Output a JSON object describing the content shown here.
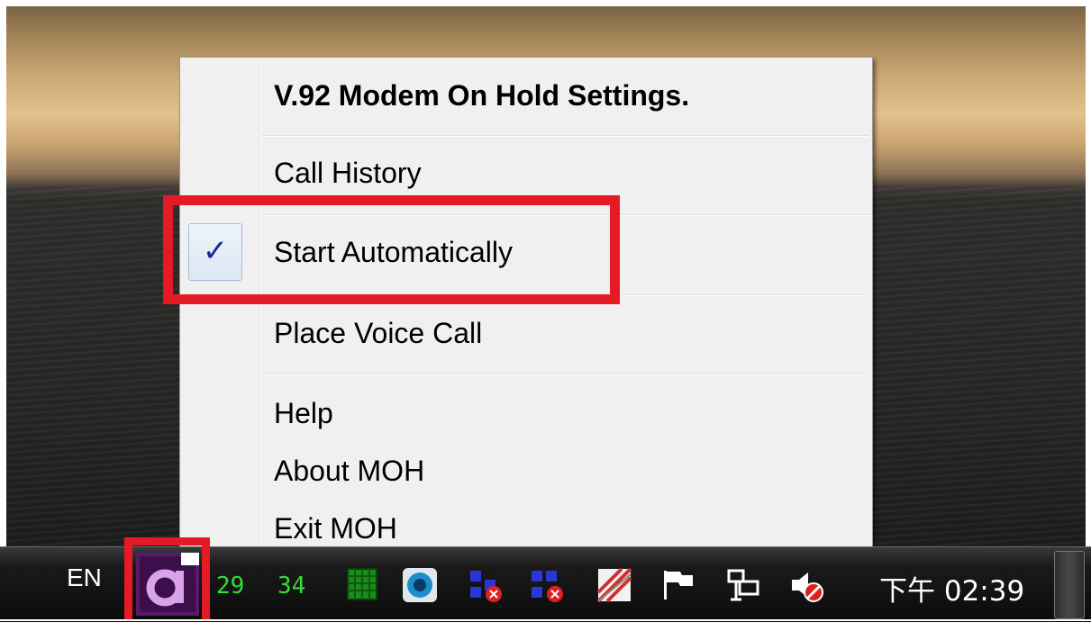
{
  "menu": {
    "items": [
      {
        "label": "V.92 Modem On Hold Settings.",
        "checked": false,
        "bold": true
      },
      {
        "label": "Call History",
        "checked": false,
        "bold": false
      },
      {
        "label": "Start Automatically",
        "checked": true,
        "bold": false
      },
      {
        "label": "Place Voice Call",
        "checked": false,
        "bold": false
      },
      {
        "label": "Help",
        "checked": false,
        "bold": false
      },
      {
        "label": "About MOH",
        "checked": false,
        "bold": false
      },
      {
        "label": "Exit MOH",
        "checked": false,
        "bold": false
      }
    ],
    "check_glyph": "✓"
  },
  "taskbar": {
    "language": "EN",
    "tray_numbers": [
      "29",
      "34"
    ],
    "tray_icons": [
      "moh-modem-icon",
      "green-grid-icon",
      "blue-circle-icon",
      "network-disconnected-icon",
      "network-disconnected-icon",
      "striped-app-icon",
      "action-center-flag-icon",
      "network-monitor-icon",
      "volume-muted-icon"
    ],
    "clock": "下午 02:39"
  },
  "colors": {
    "highlight": "#e41b24",
    "check": "#1a2a8f",
    "tray_numbers": "#33dd33",
    "menu_bg": "#f0f0f0"
  }
}
